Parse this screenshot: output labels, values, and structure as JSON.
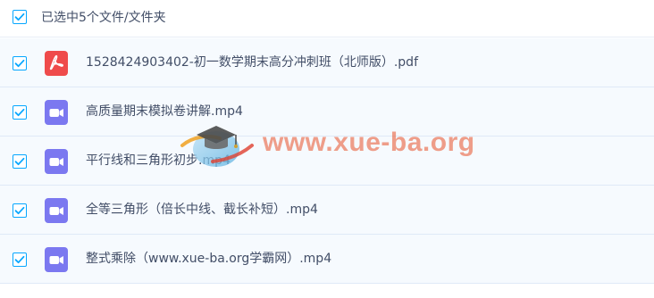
{
  "header": {
    "checked": true,
    "label": "已选中5个文件/文件夹"
  },
  "files": [
    {
      "name": "1528424903402-初一数学期末高分冲刺班（北师版）.pdf",
      "type": "pdf",
      "icon": "pdf-icon",
      "checked": true
    },
    {
      "name": "高质量期末模拟卷讲解.mp4",
      "type": "video",
      "icon": "video-icon",
      "checked": true
    },
    {
      "name": "平行线和三角形初步.mp4",
      "type": "video",
      "icon": "video-icon",
      "checked": true
    },
    {
      "name": "全等三角形（倍长中线、截长补短）.mp4",
      "type": "video",
      "icon": "video-icon",
      "checked": true
    },
    {
      "name": "整式乘除（www.xue-ba.org学霸网）.mp4",
      "type": "video",
      "icon": "video-icon",
      "checked": true
    }
  ],
  "watermark": {
    "text": "www.xue-ba.org",
    "icon": "graduation-cap-icon"
  },
  "colors": {
    "accent": "#06a7ff",
    "pdf": "#ef4b4b",
    "video": "#7b78f0",
    "row_bg": "#f6fafe",
    "text": "#424e67"
  }
}
